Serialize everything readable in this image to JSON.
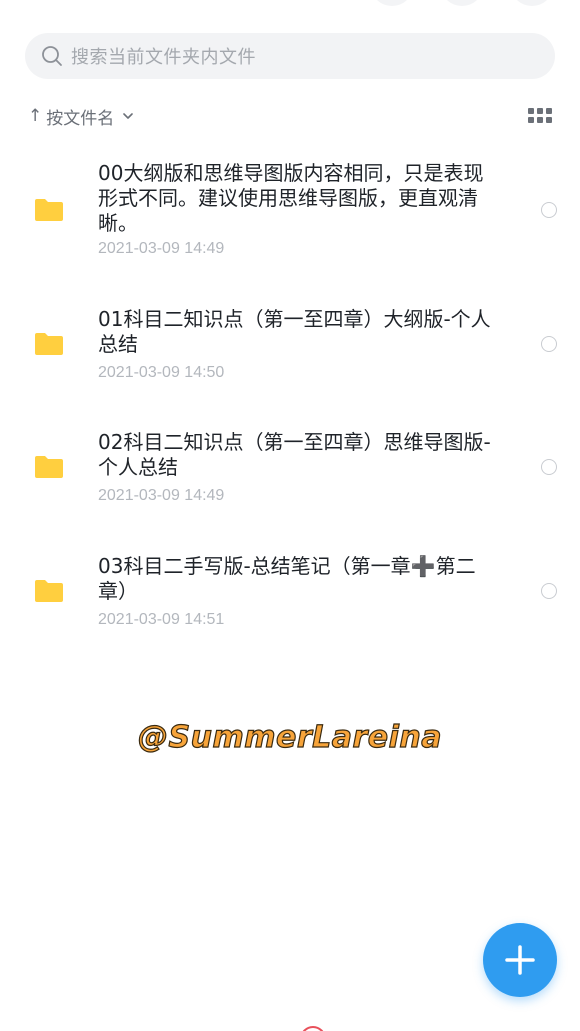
{
  "search": {
    "placeholder": "搜索当前文件夹内文件"
  },
  "sort": {
    "label": "按文件名"
  },
  "files": [
    {
      "name": "00大纲版和思维导图版内容相同，只是表现形式不同。建议使用思维导图版，更直观清晰。",
      "date": "2021-03-09 14:49"
    },
    {
      "name": "01科目二知识点（第一至四章）大纲版-个人总结",
      "date": "2021-03-09 14:50"
    },
    {
      "name": "02科目二知识点（第一至四章）思维导图版-个人总结",
      "date": "2021-03-09 14:49"
    },
    {
      "name": "03科目二手写版-总结笔记（第一章➕第二章）",
      "date": "2021-03-09 14:51"
    }
  ],
  "watermark": "@SummerLareina",
  "colors": {
    "accent": "#2f9cf0",
    "folder": "#ffcf3f",
    "watermark": "#f7a43a"
  },
  "icons": {
    "search": "search-icon",
    "sort_direction": "arrow-up-icon",
    "view": "grid-view-icon",
    "add": "plus-icon",
    "folder": "folder-icon"
  }
}
